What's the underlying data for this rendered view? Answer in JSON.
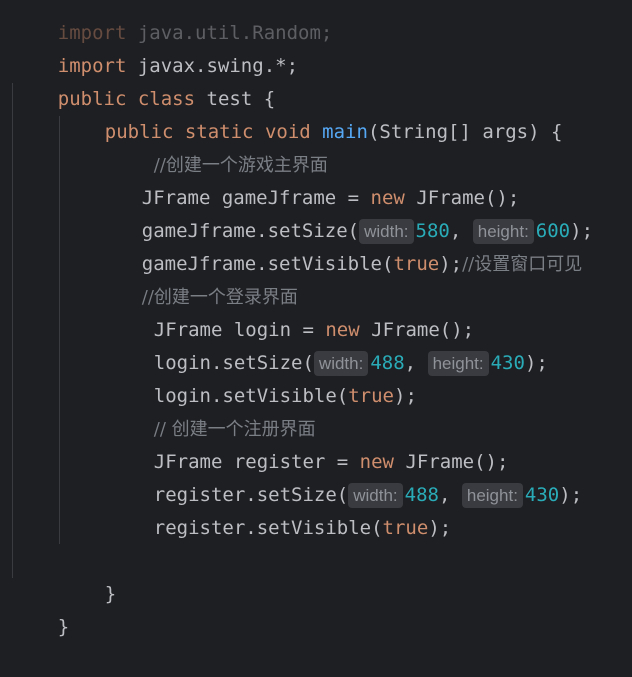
{
  "code": {
    "line0_import_kw": "import",
    "line0_import_path": "java.util.Random;",
    "line1_import_kw": "import",
    "line1_import_path": "javax.swing.*;",
    "class_public": "public",
    "class_kw": "class",
    "class_name": "test",
    "brace_open": "{",
    "main_public": "public",
    "main_static": "static",
    "main_void": "void",
    "main_name": "main",
    "main_params": "(String[] args) {",
    "c1": "//创建一个游戏主界面",
    "l_game_type": "JFrame gameJframe = ",
    "l_game_new": "new",
    "l_game_ctor": " JFrame();",
    "l_game_setsize": "gameJframe.setSize(",
    "hint_width": "width:",
    "hint_height": "height:",
    "game_w": "580",
    "game_h": "600",
    "l_game_visible": "gameJframe.setVisible(",
    "true_kw": "true",
    "l_game_visible_end": ");",
    "c_visible": "//设置窗口可见",
    "c2": "//创建一个登录界面",
    "l_login_type": "JFrame login = ",
    "l_login_ctor": " JFrame();",
    "l_login_setsize": "login.setSize(",
    "login_w": "488",
    "login_h": "430",
    "l_login_visible": "login.setVisible(",
    "c3": "// 创建一个注册界面",
    "l_reg_type": "JFrame register = ",
    "l_reg_ctor": " JFrame();",
    "l_reg_setsize": "register.setSize(",
    "reg_w": "488",
    "reg_h": "430",
    "l_reg_visible": "register.setVisible(",
    "close_paren_semicolon": ");",
    "comma": ", ",
    "close_main": "}",
    "close_class": "}"
  },
  "colors": {
    "background": "#1e1f22",
    "keyword": "#cf8e6d",
    "method": "#56a8f5",
    "number": "#2aacb8",
    "comment": "#7a7e85",
    "text": "#bcbec4",
    "hint_bg": "#393b40"
  }
}
